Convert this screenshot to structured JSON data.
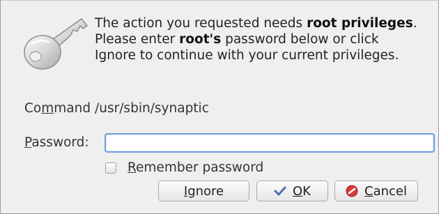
{
  "message": {
    "part1": "The action you requested needs ",
    "bold1": "root privileges",
    "part2": ". Please enter ",
    "bold2": "root's",
    "part3": " password below or click Ignore to continue with your current privileges."
  },
  "command": {
    "label_pre": "Co",
    "label_mnemonic": "m",
    "label_post": "mand",
    "value": "/usr/sbin/synaptic"
  },
  "password": {
    "label_mnemonic": "P",
    "label_post": "assword:",
    "value": ""
  },
  "remember": {
    "label_mnemonic": "R",
    "label_post": "emember password",
    "checked": false
  },
  "buttons": {
    "ignore": {
      "label_mnemonic": "I",
      "label_post": "gnore"
    },
    "ok": {
      "label_mnemonic": "O",
      "label_post": "K",
      "icon": "checkmark-icon"
    },
    "cancel": {
      "label_mnemonic": "C",
      "label_post": "ancel",
      "icon": "cancel-icon"
    }
  },
  "colors": {
    "dialog_bg": "#efefef",
    "focus_border": "#6d9fd9",
    "cancel_red": "#d23c3c",
    "ok_blue": "#4a6fb5"
  },
  "icons": {
    "key": "key-icon"
  }
}
